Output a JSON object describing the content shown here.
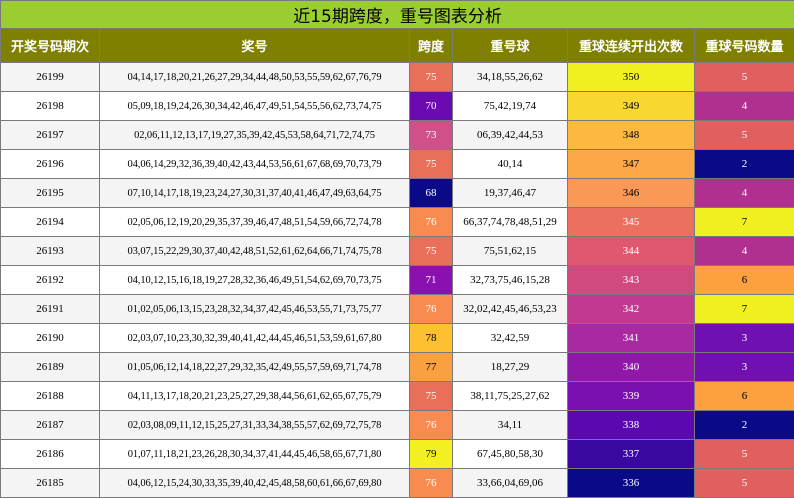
{
  "title": "近15期跨度，重号图表分析",
  "headers": [
    "开奖号码期次",
    "奖号",
    "跨度",
    "重号球",
    "重球连续开出次数",
    "重球号码数量"
  ],
  "rows": [
    {
      "issue": "26199",
      "numbers": "04,14,17,18,20,21,26,27,29,34,44,48,50,53,55,59,62,67,76,79",
      "span": "75",
      "repeat_balls": "34,18,55,26,62",
      "consecutive": "350",
      "count": "5",
      "span_color": "#e8705a",
      "cons_color": "#f0f020",
      "count_color": "#e06060"
    },
    {
      "issue": "26198",
      "numbers": "05,09,18,19,24,26,30,34,42,46,47,49,51,54,55,56,62,73,74,75",
      "span": "70",
      "repeat_balls": "75,42,19,74",
      "consecutive": "349",
      "count": "4",
      "span_color": "#6a0ab0",
      "cons_color": "#f8d830",
      "count_color": "#b03090"
    },
    {
      "issue": "26197",
      "numbers": "02,06,11,12,13,17,19,27,35,39,42,45,53,58,64,71,72,74,75",
      "span": "73",
      "repeat_balls": "06,39,42,44,53",
      "consecutive": "348",
      "count": "5",
      "span_color": "#d0508a",
      "cons_color": "#fdb840",
      "count_color": "#e06060"
    },
    {
      "issue": "26196",
      "numbers": "04,06,14,29,32,36,39,40,42,43,44,53,56,61,67,68,69,70,73,79",
      "span": "75",
      "repeat_balls": "40,14",
      "consecutive": "347",
      "count": "2",
      "span_color": "#e8705a",
      "cons_color": "#fca848",
      "count_color": "#0a0a88"
    },
    {
      "issue": "26195",
      "numbers": "07,10,14,17,18,19,23,24,27,30,31,37,40,41,46,47,49,63,64,75",
      "span": "68",
      "repeat_balls": "19,37,46,47",
      "consecutive": "346",
      "count": "4",
      "span_color": "#0a0a88",
      "cons_color": "#fa9858",
      "count_color": "#b03090"
    },
    {
      "issue": "26194",
      "numbers": "02,05,06,12,19,20,29,35,37,39,46,47,48,51,54,59,66,72,74,78",
      "span": "76",
      "repeat_balls": "66,37,74,78,48,51,29",
      "consecutive": "345",
      "count": "7",
      "span_color": "#f88c50",
      "cons_color": "#ec7060",
      "count_color": "#f0f020"
    },
    {
      "issue": "26193",
      "numbers": "03,07,15,22,29,30,37,40,42,48,51,52,61,62,64,66,71,74,75,78",
      "span": "75",
      "repeat_balls": "75,51,62,15",
      "consecutive": "344",
      "count": "4",
      "span_color": "#e8705a",
      "cons_color": "#e05870",
      "count_color": "#b03090"
    },
    {
      "issue": "26192",
      "numbers": "04,10,12,15,16,18,19,27,28,32,36,46,49,51,54,62,69,70,73,75",
      "span": "71",
      "repeat_balls": "32,73,75,46,15,28",
      "consecutive": "343",
      "count": "6",
      "span_color": "#8a10b0",
      "cons_color": "#d04a80",
      "count_color": "#fca040"
    },
    {
      "issue": "26191",
      "numbers": "01,02,05,06,13,15,23,28,32,34,37,42,45,46,53,55,71,73,75,77",
      "span": "76",
      "repeat_balls": "32,02,42,45,46,53,23",
      "consecutive": "342",
      "count": "7",
      "span_color": "#f88c50",
      "cons_color": "#c03a90",
      "count_color": "#f0f020"
    },
    {
      "issue": "26190",
      "numbers": "02,03,07,10,23,30,32,39,40,41,42,44,45,46,51,53,59,61,67,80",
      "span": "78",
      "repeat_balls": "32,42,59",
      "consecutive": "341",
      "count": "3",
      "span_color": "#fdc030",
      "cons_color": "#a82aa0",
      "count_color": "#7010b0"
    },
    {
      "issue": "26189",
      "numbers": "01,05,06,12,14,18,22,27,29,32,35,42,49,55,57,59,69,71,74,78",
      "span": "77",
      "repeat_balls": "18,27,29",
      "consecutive": "340",
      "count": "3",
      "span_color": "#fba040",
      "cons_color": "#9018a8",
      "count_color": "#7010b0"
    },
    {
      "issue": "26188",
      "numbers": "04,11,13,17,18,20,21,23,25,27,29,38,44,56,61,62,65,67,75,79",
      "span": "75",
      "repeat_balls": "38,11,75,25,27,62",
      "consecutive": "339",
      "count": "6",
      "span_color": "#e8705a",
      "cons_color": "#7a10b0",
      "count_color": "#fca040"
    },
    {
      "issue": "26187",
      "numbers": "02,03,08,09,11,12,15,25,27,31,33,34,38,55,57,62,69,72,75,78",
      "span": "76",
      "repeat_balls": "34,11",
      "consecutive": "338",
      "count": "2",
      "span_color": "#f88c50",
      "cons_color": "#5a08b0",
      "count_color": "#0a0a88"
    },
    {
      "issue": "26186",
      "numbers": "01,07,11,18,21,23,26,28,30,34,37,41,44,45,46,58,65,67,71,80",
      "span": "79",
      "repeat_balls": "67,45,80,58,30",
      "consecutive": "337",
      "count": "5",
      "span_color": "#f2f020",
      "cons_color": "#3a08a0",
      "count_color": "#e06060"
    },
    {
      "issue": "26185",
      "numbers": "04,06,12,15,24,30,33,35,39,40,42,45,48,58,60,61,66,67,69,80",
      "span": "76",
      "repeat_balls": "33,66,04,69,06",
      "consecutive": "336",
      "count": "5",
      "span_color": "#f88c50",
      "cons_color": "#0a0a88",
      "count_color": "#e06060"
    }
  ]
}
